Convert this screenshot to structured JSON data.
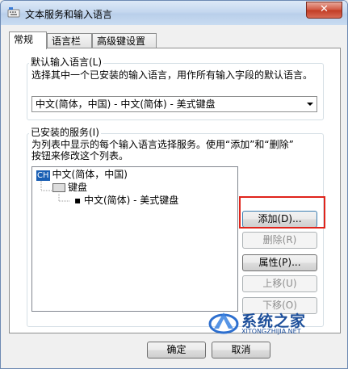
{
  "window": {
    "title": "文本服务和输入语言",
    "close_label": "✕"
  },
  "tabs": [
    {
      "label": "常规",
      "active": true
    },
    {
      "label": "语言栏",
      "active": false
    },
    {
      "label": "高级键设置",
      "active": false
    }
  ],
  "default_language": {
    "label": "默认输入语言(L)",
    "description": "选择其中一个已安装的输入语言，用作所有输入字段的默认语言。",
    "selected": "中文(简体，中国) - 中文(简体) - 美式键盘"
  },
  "installed_services": {
    "label": "已安装的服务(I)",
    "description_line1": "为列表中显示的每个输入语言选择服务。使用“添加”和“删除”",
    "description_line2": "按钮来修改这个列表。",
    "tree": {
      "language_badge": "CH",
      "language": "中文(简体，中国)",
      "category": "键盘",
      "item": "中文(简体) - 美式键盘"
    },
    "buttons": {
      "add": "添加(D)...",
      "remove": "删除(R)",
      "properties": "属性(P)...",
      "move_up": "上移(U)",
      "move_down": "下移(O)"
    }
  },
  "footer": {
    "ok": "确定",
    "cancel": "取消"
  },
  "watermark": {
    "name": "系统之家",
    "url": "XITONGZHIJIA.NET"
  },
  "colors": {
    "highlight": "#e0241b",
    "brand": "#1c4e9a"
  }
}
